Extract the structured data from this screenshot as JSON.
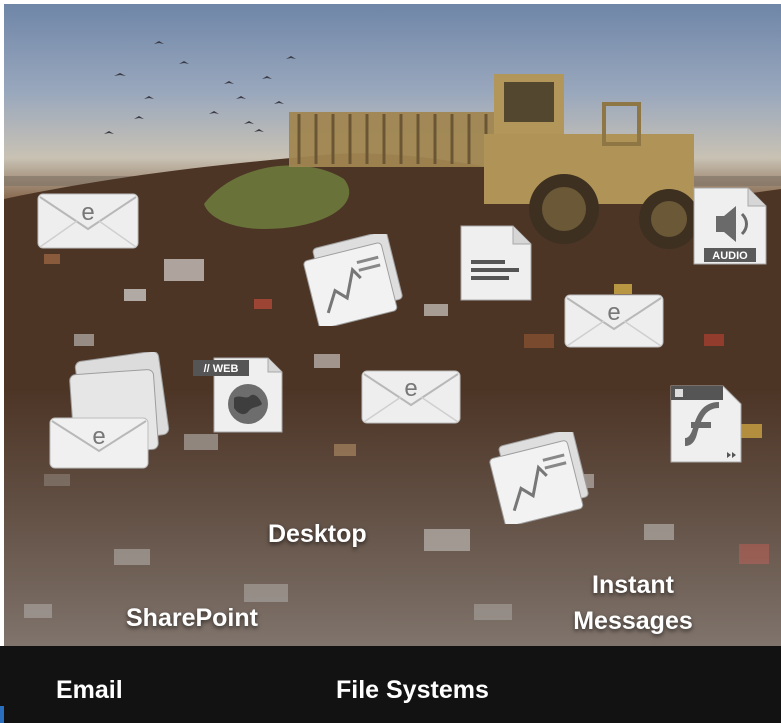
{
  "labels": {
    "desktop": "Desktop",
    "sharepoint": "SharePoint",
    "instant_messages_line1": "Instant",
    "instant_messages_line2": "Messages"
  },
  "footer": {
    "email": "Email",
    "file_systems": "File Systems"
  },
  "icons": {
    "email_glyph": "e",
    "web_badge": "// WEB",
    "audio_badge": "AUDIO"
  },
  "colors": {
    "footer_bg": "#121212",
    "label_text": "#ffffff",
    "accent": "#2a6fbf"
  }
}
